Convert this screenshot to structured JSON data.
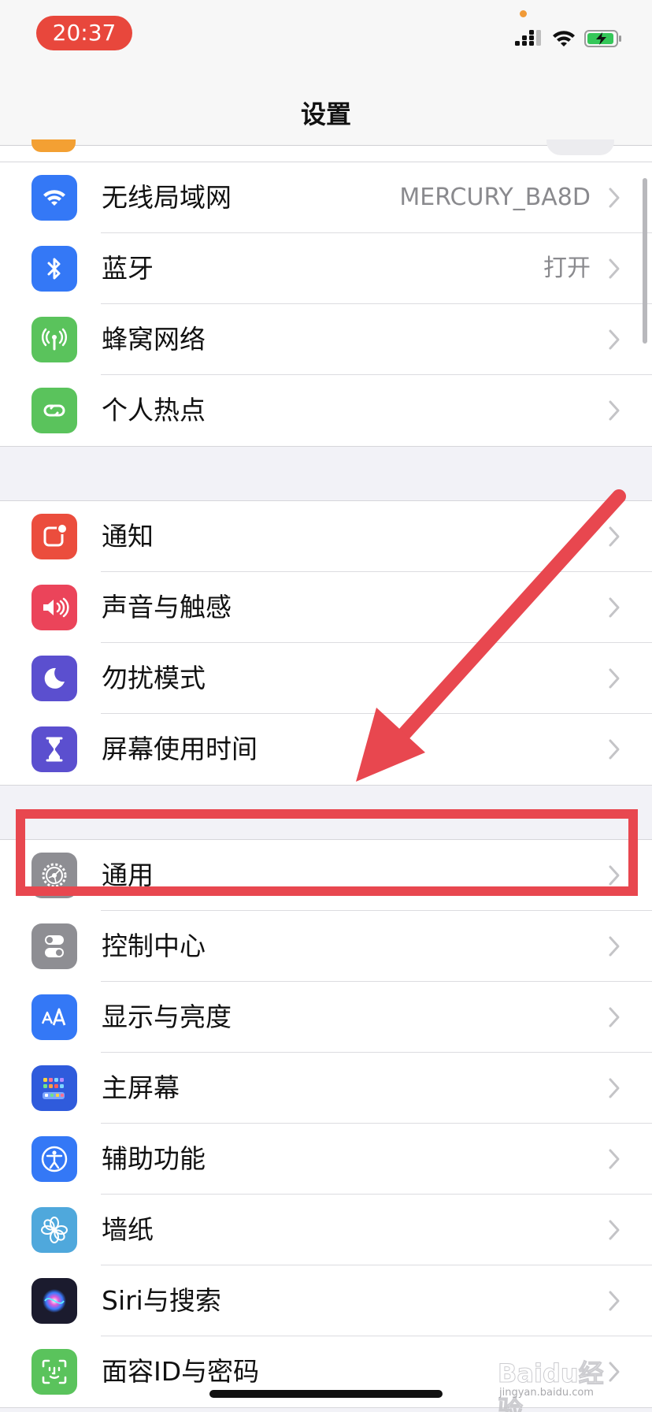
{
  "status_bar": {
    "time": "20:37"
  },
  "nav": {
    "title": "设置"
  },
  "groups": [
    {
      "rows": [
        {
          "label": "无线局域网",
          "value": "MERCURY_BA8D",
          "icon": "wifi-icon",
          "color": "#3478f6"
        },
        {
          "label": "蓝牙",
          "value": "打开",
          "icon": "bluetooth-icon",
          "color": "#3478f6"
        },
        {
          "label": "蜂窝网络",
          "icon": "cellular-icon",
          "color": "#5ac35c"
        },
        {
          "label": "个人热点",
          "icon": "hotspot-icon",
          "color": "#5ac35c"
        }
      ]
    },
    {
      "rows": [
        {
          "label": "通知",
          "icon": "notifications-icon",
          "color": "#eb4d3d"
        },
        {
          "label": "声音与触感",
          "icon": "sound-icon",
          "color": "#eb445a"
        },
        {
          "label": "勿扰模式",
          "icon": "moon-icon",
          "color": "#5b4fcf"
        },
        {
          "label": "屏幕使用时间",
          "icon": "hourglass-icon",
          "color": "#5b4fcf"
        }
      ]
    },
    {
      "rows": [
        {
          "label": "通用",
          "icon": "gear-icon",
          "color": "#8e8e93"
        },
        {
          "label": "控制中心",
          "icon": "toggles-icon",
          "color": "#8e8e93"
        },
        {
          "label": "显示与亮度",
          "icon": "text-size-icon",
          "color": "#3478f6"
        },
        {
          "label": "主屏幕",
          "icon": "home-screen-icon",
          "color": "#2f5bdc"
        },
        {
          "label": "辅助功能",
          "icon": "accessibility-icon",
          "color": "#3478f6"
        },
        {
          "label": "墙纸",
          "icon": "flower-icon",
          "color": "#4fa8dc"
        },
        {
          "label": "Siri与搜索",
          "icon": "siri-icon",
          "color": "#1b1b2e"
        },
        {
          "label": "面容ID与密码",
          "icon": "face-id-icon",
          "color": "#5ac35c"
        }
      ]
    }
  ],
  "annotation": {
    "color": "#e8474f",
    "highlighted_item": "通用"
  },
  "watermark": {
    "text": "Baidu经验",
    "sub": "jingyan.baidu.com"
  }
}
